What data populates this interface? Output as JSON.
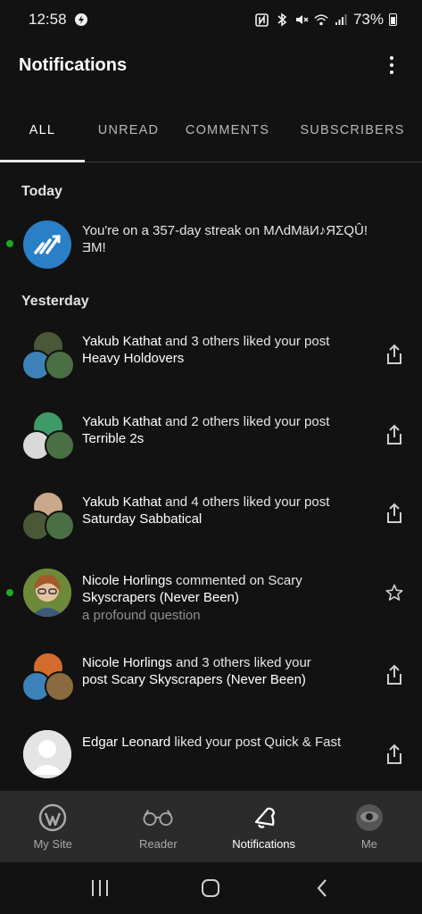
{
  "status_bar": {
    "time": "12:58",
    "battery": "73%",
    "icons": [
      "data-saver-icon",
      "nfc-icon",
      "bluetooth-icon",
      "mute-icon",
      "wifi-icon",
      "signal-icon",
      "battery-icon"
    ]
  },
  "header": {
    "title": "Notifications",
    "more_icon": "more-vertical-icon"
  },
  "tabs": [
    {
      "label": "ALL",
      "active": true
    },
    {
      "label": "UNREAD",
      "active": false
    },
    {
      "label": "COMMENTS",
      "active": false
    },
    {
      "label": "SUBSCRIBERS",
      "active": false
    }
  ],
  "sections": {
    "today": "Today",
    "yesterday": "Yesterday"
  },
  "notifications": {
    "streak": {
      "line1": "You're on a 357-day streak on ΜΛdΜäИ♪ЯΣQÛ!",
      "line2": "ƎM!",
      "unread": true,
      "icon": "streak-icon"
    },
    "n1": {
      "actor": "Yakub Kathat",
      "rest": " and 3 others liked your post",
      "post": "Heavy Holdovers",
      "action_icon": "share-icon"
    },
    "n2": {
      "actor": "Yakub Kathat",
      "rest": " and 2 others liked your post",
      "post": "Terrible 2s",
      "action_icon": "share-icon"
    },
    "n3": {
      "actor": "Yakub Kathat",
      "rest": " and 4 others liked your post",
      "post": "Saturday Sabbatical",
      "action_icon": "share-icon"
    },
    "n4": {
      "actor": "Nicole Horlings",
      "rest": " commented on Scary",
      "post": "Skyscrapers (Never Been)",
      "excerpt": "a profound question",
      "unread": true,
      "action_icon": "star-icon"
    },
    "n5": {
      "actor": "Nicole Horlings",
      "rest": " and 3 others liked your",
      "post": "post Scary Skyscrapers (Never Been)",
      "action_icon": "share-icon"
    },
    "n6": {
      "actor": "Edgar Leonard",
      "rest": " liked your post Quick & Fast",
      "action_icon": "share-icon"
    }
  },
  "bottom_nav": [
    {
      "label": "My Site",
      "icon": "wordpress-icon",
      "active": false
    },
    {
      "label": "Reader",
      "icon": "glasses-icon",
      "active": false
    },
    {
      "label": "Notifications",
      "icon": "bell-icon",
      "active": true
    },
    {
      "label": "Me",
      "icon": "avatar-icon",
      "active": false
    }
  ],
  "system_nav": [
    "recents-icon",
    "home-icon",
    "back-icon"
  ],
  "colors": {
    "background": "#121212",
    "unread_dot": "#1fa82a",
    "streak_blue": "#2a7fc7",
    "nav_background": "#2b2b2b"
  }
}
